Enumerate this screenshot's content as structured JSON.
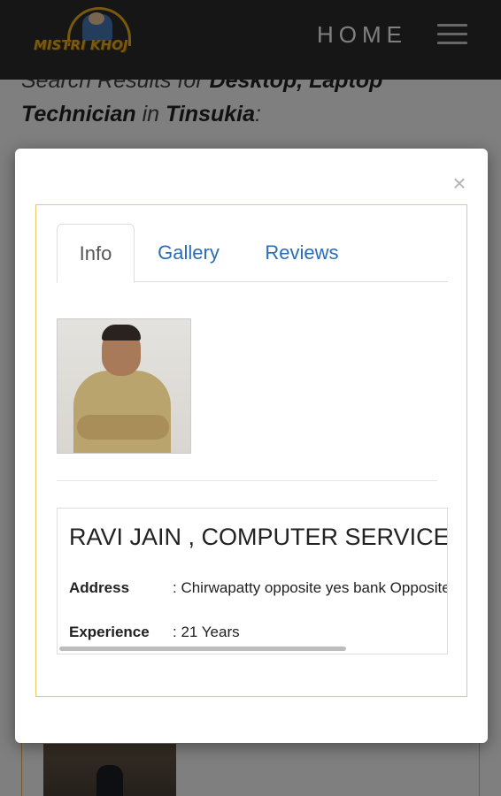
{
  "navbar": {
    "logo_text": "MISTRI KHOJ",
    "home_label": "HOME"
  },
  "search": {
    "prefix": "Search Results for ",
    "service": "Desktop, Laptop Technician",
    "in_word": " in ",
    "city": "Tinsukia",
    "suffix": ":"
  },
  "modal": {
    "close_symbol": "×",
    "tabs": [
      {
        "label": "Info",
        "active": true
      },
      {
        "label": "Gallery",
        "active": false
      },
      {
        "label": "Reviews",
        "active": false
      }
    ],
    "business_name": "RAVI JAIN , COMPUTER SERVICE",
    "address_label": "Address",
    "address_value": ": Chirwapatty opposite yes bank Opposite",
    "experience_label": "Experience",
    "experience_value": ": 21 Years"
  },
  "colors": {
    "navbar_bg": "#2d2d2d",
    "accent_border": "#f2c66a",
    "tab_link": "#2a6db5",
    "logo_gold": "#f0b21a"
  },
  "icons": {
    "menu": "hamburger-icon",
    "close": "close-icon"
  }
}
